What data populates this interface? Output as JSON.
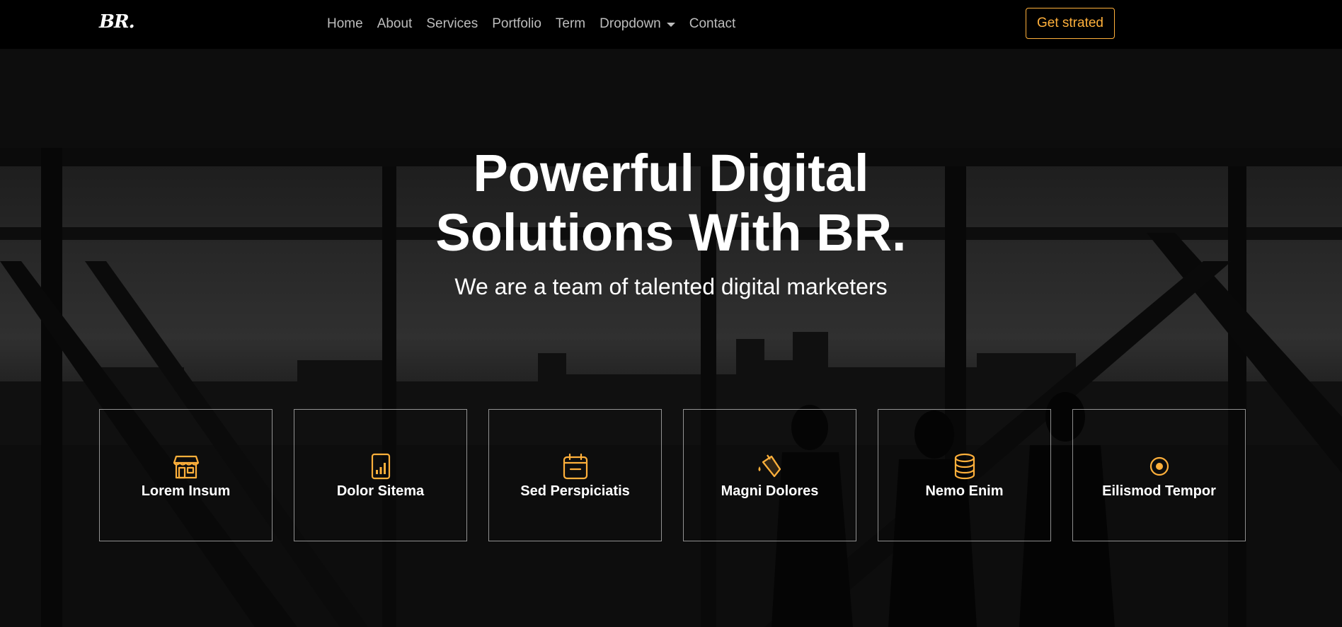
{
  "brand": {
    "logo": "BR."
  },
  "nav": {
    "items": [
      {
        "label": "Home"
      },
      {
        "label": "About"
      },
      {
        "label": "Services"
      },
      {
        "label": "Portfolio"
      },
      {
        "label": "Term"
      },
      {
        "label": "Dropdown"
      },
      {
        "label": "Contact"
      }
    ],
    "cta_label": "Get strated"
  },
  "hero": {
    "title_line1": "Powerful Digital",
    "title_line2": "Solutions With BR.",
    "subtitle": "We are a team of talented digital marketers"
  },
  "features": [
    {
      "title": "Lorem Insum",
      "icon": "store-icon"
    },
    {
      "title": "Dolor Sitema",
      "icon": "bar-chart-icon"
    },
    {
      "title": "Sed Perspiciatis",
      "icon": "calendar-icon"
    },
    {
      "title": "Magni Dolores",
      "icon": "paint-bucket-icon"
    },
    {
      "title": "Nemo Enim",
      "icon": "database-icon"
    },
    {
      "title": "Eilismod Tempor",
      "icon": "record-icon"
    }
  ],
  "colors": {
    "accent": "#ffb03b",
    "navbar_bg": "#000000",
    "nav_link": "#bdbdbd",
    "text": "#ffffff"
  }
}
